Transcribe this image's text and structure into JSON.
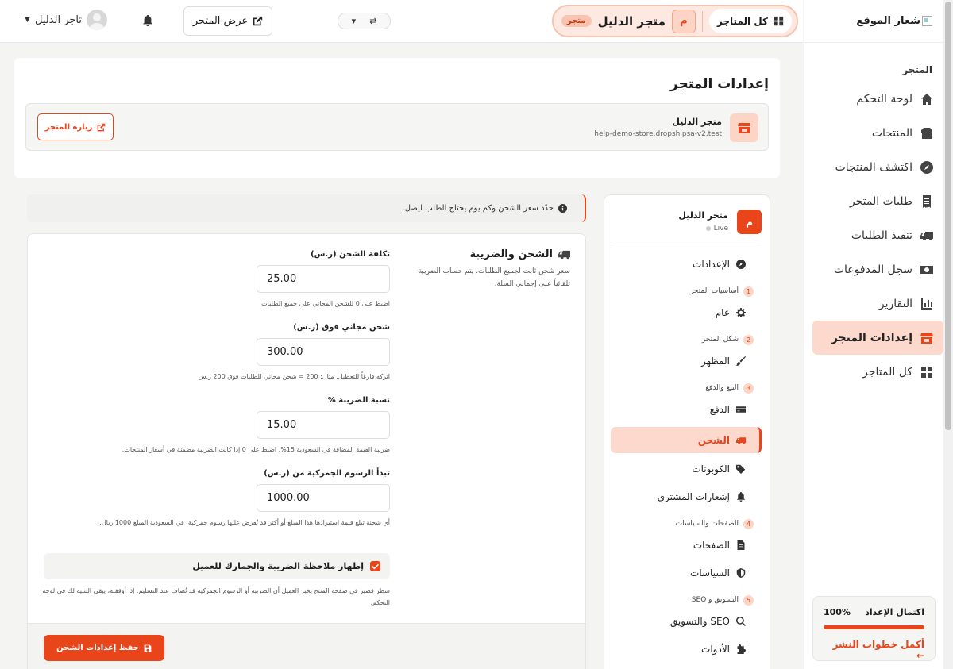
{
  "sidebar": {
    "logo_text": "شعار الموقع",
    "section_title": "المتجر",
    "items": [
      {
        "label": "لوحة التحكم",
        "icon": "home-icon"
      },
      {
        "label": "المنتجات",
        "icon": "box-icon"
      },
      {
        "label": "اكتشف المنتجات",
        "icon": "compass-icon"
      },
      {
        "label": "طلبات المتجر",
        "icon": "receipt-icon"
      },
      {
        "label": "تنفيذ الطلبات",
        "icon": "truck-icon"
      },
      {
        "label": "سجل المدفوعات",
        "icon": "money-icon"
      },
      {
        "label": "التقارير",
        "icon": "chart-icon"
      },
      {
        "label": "إعدادات المتجر",
        "icon": "store-icon",
        "active": true
      },
      {
        "label": "كل المتاجر",
        "icon": "grid-icon"
      }
    ],
    "progress": {
      "title": "اكتمال الإعداد",
      "percent_label": "100%",
      "percent": 100,
      "link": "أكمل خطوات النشر ←"
    }
  },
  "topbar": {
    "all_stores": "كل المتاجر",
    "store_avatar": "م",
    "store_name": "متجر الدليل",
    "store_tag": "متجر",
    "view_store": "عرض المتجر",
    "user_name": "تاجر الدليل"
  },
  "page": {
    "title": "إعدادات المتجر",
    "store_name": "متجر الدليل",
    "store_url": "help-demo-store.dropshipsa-v2.test",
    "visit_store": "زيارة المتجر"
  },
  "settings_nav": {
    "store_avatar": "م",
    "store_name": "متجر الدليل",
    "status": "Live",
    "overview": "الإعدادات",
    "groups": [
      {
        "num": "1",
        "title": "أساسيات المتجر",
        "items": [
          {
            "label": "عام"
          }
        ]
      },
      {
        "num": "2",
        "title": "شكل المتجر",
        "items": [
          {
            "label": "المظهر"
          }
        ]
      },
      {
        "num": "3",
        "title": "البيع والدفع",
        "items": [
          {
            "label": "الدفع"
          },
          {
            "label": "الشحن",
            "active": true
          },
          {
            "label": "الكوبونات"
          },
          {
            "label": "إشعارات المشتري"
          }
        ]
      },
      {
        "num": "4",
        "title": "الصفحات والسياسات",
        "items": [
          {
            "label": "الصفحات"
          },
          {
            "label": "السياسات"
          }
        ]
      },
      {
        "num": "5",
        "title": "التسويق و SEO",
        "items": [
          {
            "label": "SEO والتسويق"
          },
          {
            "label": "الأدوات"
          }
        ]
      }
    ]
  },
  "banner": "حدّد سعر الشحن وكم يوم يحتاج الطلب ليصل.",
  "form": {
    "section_title": "الشحن والضريبة",
    "section_desc": "سعر شحن ثابت لجميع الطلبات. يتم حساب الضريبة تلقائياً على إجمالي السلة.",
    "fields": [
      {
        "label": "تكلفة الشحن (ر.س)",
        "value": "25.00",
        "hint": "اضبط على 0 للشحن المجاني على جميع الطلبات"
      },
      {
        "label": "شحن مجاني فوق (ر.س)",
        "value": "300.00",
        "hint": "اتركه فارغاً للتعطيل. مثال: 200 = شحن مجاني للطلبات فوق 200 ر.س"
      },
      {
        "label": "نسبة الضريبة %",
        "value": "15.00",
        "hint": "ضريبة القيمة المضافة في السعودية 15%. اضبط على 0 إذا كانت الضريبة مضمنة في أسعار المنتجات."
      },
      {
        "label": "تبدأ الرسوم الجمركية من (ر.س)",
        "value": "1000.00",
        "hint": "أي شحنة تبلغ قيمة استيرادها هذا المبلغ أو أكثر قد تُفرض عليها رسوم جمركية. في السعودية المبلغ 1000 ريال."
      }
    ],
    "toggle_label": "إظهار ملاحظة الضريبة والجمارك للعميل",
    "toggle_checked": true,
    "toggle_hint": "سطر قصير في صفحة المنتج يخبر العميل أن الضريبة أو الرسوم الجمركية قد تُضاف عند التسليم. إذا أوقفته، يبقى التنبيه لك في لوحة التحكم.",
    "save_label": "حفظ إعدادات الشحن"
  }
}
